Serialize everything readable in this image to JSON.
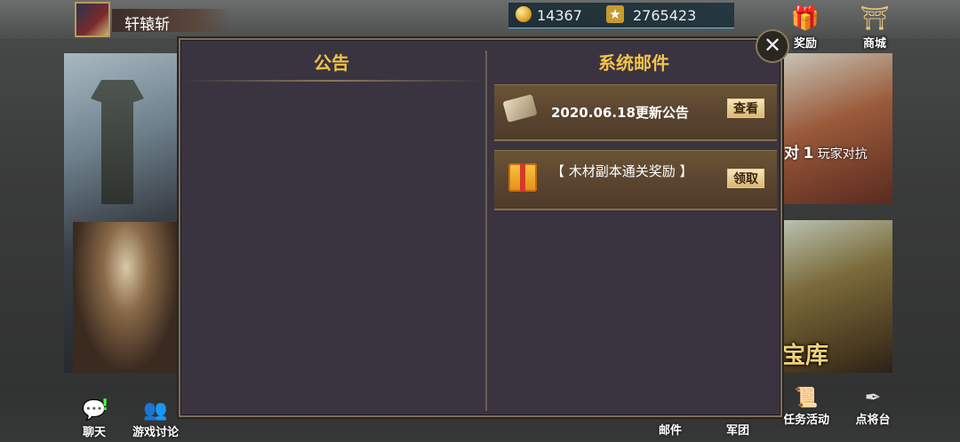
{
  "player": {
    "name": "轩辕斩"
  },
  "currency": {
    "coins": "14367",
    "stars": "2765423"
  },
  "top_buttons": {
    "reward": "奖励",
    "shop": "商城"
  },
  "background_cards": {
    "pvp_prefix": "对",
    "pvp_number": "1",
    "pvp_label": "玩家对抗",
    "treasure": "宝库"
  },
  "bottom_nav": {
    "chat": "聊天",
    "discussion": "游戏讨论",
    "mail": "邮件",
    "legion": "军团",
    "quests": "任务活动",
    "arena": "点将台"
  },
  "dialog": {
    "left_title": "公告",
    "right_title": "系统邮件",
    "mails": [
      {
        "text": "2020.06.18更新公告",
        "button": "查看",
        "icon": "scroll-icon"
      },
      {
        "text": "【 木材副本通关奖励 】",
        "button": "领取",
        "icon": "gift-icon"
      }
    ],
    "close_symbol": "✕"
  },
  "colors": {
    "title": "#f2c24a",
    "panel": "#3a3440",
    "accent": "#8a6e48"
  }
}
